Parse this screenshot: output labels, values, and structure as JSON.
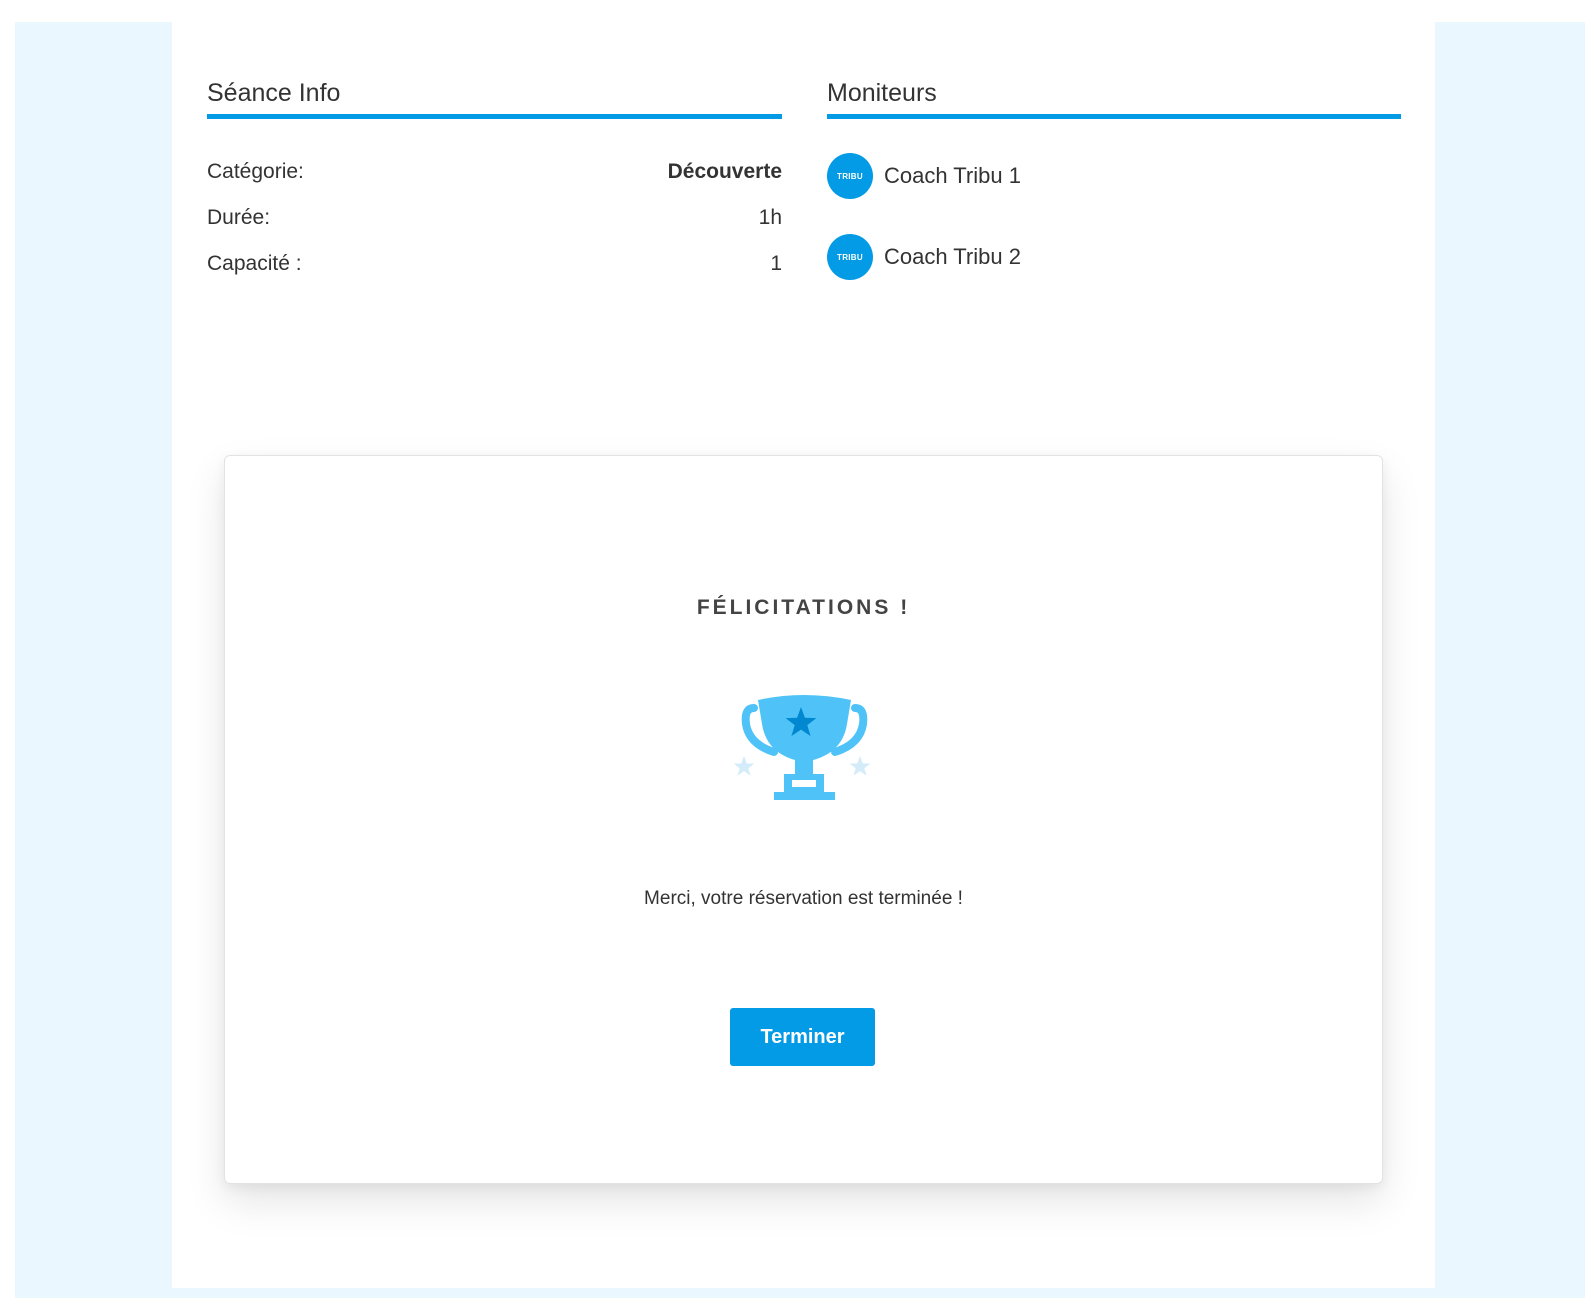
{
  "session_info": {
    "title": "Séance Info",
    "rows": [
      {
        "label": "Catégorie:",
        "value": "Découverte"
      },
      {
        "label": "Durée:",
        "value": "1h"
      },
      {
        "label": "Capacité :",
        "value": "1"
      }
    ]
  },
  "instructors": {
    "title": "Moniteurs",
    "items": [
      {
        "avatar_text": "TRIBU",
        "name": "Coach Tribu 1"
      },
      {
        "avatar_text": "TRIBU",
        "name": "Coach Tribu 2"
      }
    ]
  },
  "confirmation": {
    "title": "FÉLICITATIONS !",
    "icon": "trophy-icon",
    "message": "Merci, votre réservation est terminée !",
    "button_label": "Terminer"
  },
  "colors": {
    "accent": "#039be5",
    "page_background": "#eaf7fe",
    "trophy_light": "#4fc3f7",
    "trophy_dark": "#039be5"
  }
}
